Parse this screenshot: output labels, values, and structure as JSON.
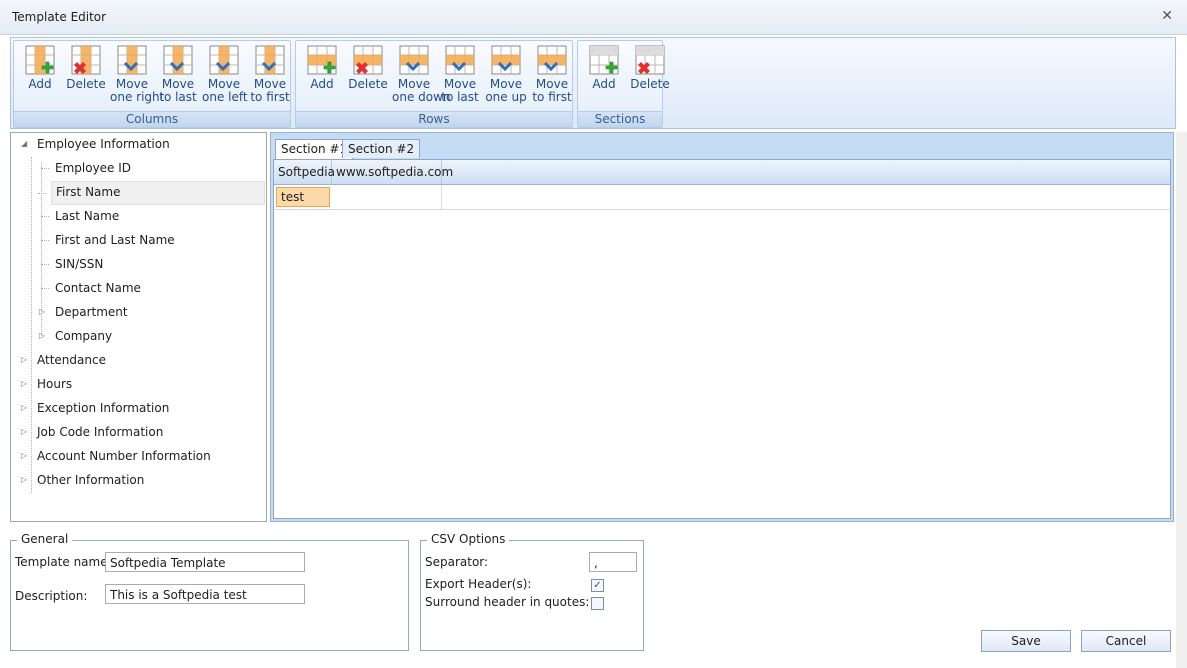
{
  "window": {
    "title": "Template Editor"
  },
  "ribbon": {
    "columns": {
      "label": "Columns",
      "buttons": [
        {
          "l1": "Add",
          "l2": ""
        },
        {
          "l1": "Delete",
          "l2": ""
        },
        {
          "l1": "Move",
          "l2": "one right"
        },
        {
          "l1": "Move",
          "l2": "to last"
        },
        {
          "l1": "Move",
          "l2": "one left"
        },
        {
          "l1": "Move",
          "l2": "to first"
        }
      ]
    },
    "rows": {
      "label": "Rows",
      "buttons": [
        {
          "l1": "Add",
          "l2": ""
        },
        {
          "l1": "Delete",
          "l2": ""
        },
        {
          "l1": "Move",
          "l2": "one down"
        },
        {
          "l1": "Move",
          "l2": "to last"
        },
        {
          "l1": "Move",
          "l2": "one up"
        },
        {
          "l1": "Move",
          "l2": "to first"
        }
      ]
    },
    "sections": {
      "label": "Sections",
      "buttons": [
        {
          "l1": "Add",
          "l2": ""
        },
        {
          "l1": "Delete",
          "l2": ""
        }
      ]
    }
  },
  "tree": {
    "root": "Employee Information",
    "children": [
      "Employee ID",
      "First Name",
      "Last Name",
      "First and Last Name",
      "SIN/SSN",
      "Contact Name",
      "Department",
      "Company"
    ],
    "others": [
      "Attendance",
      "Hours",
      "Exception Information",
      "Job Code Information",
      "Account Number Information",
      "Other Information"
    ]
  },
  "editor": {
    "tabs": [
      "Section #1",
      "Section #2"
    ],
    "headers": [
      "Softpedia",
      "www.softpedia.com"
    ],
    "row": [
      "test",
      ""
    ]
  },
  "general": {
    "legend": "General",
    "name_label": "Template name:",
    "name_value": "Softpedia Template",
    "desc_label": "Description:",
    "desc_value": "This is a Softpedia test"
  },
  "csv": {
    "legend": "CSV Options",
    "separator_label": "Separator:",
    "separator_value": ",",
    "export_label": "Export Header(s):",
    "export_checked": true,
    "surround_label": "Surround header in quotes:",
    "surround_checked": false
  },
  "buttons": {
    "save": "Save",
    "cancel": "Cancel"
  },
  "colors": {
    "accent": "#1f4d8a",
    "selection": "#fbd9a8",
    "ribbon": "#dde9f8"
  }
}
